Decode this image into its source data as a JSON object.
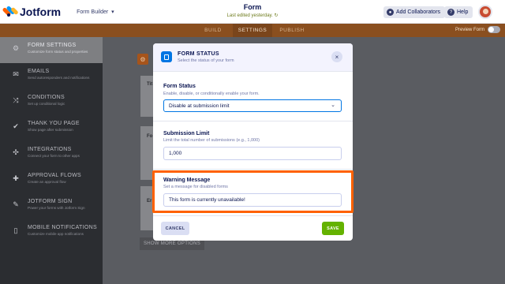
{
  "topbar": {
    "brand": "Jotform",
    "form_builder": "Form Builder",
    "form_builder_chevron": "▾",
    "doc_title": "Form",
    "last_edited": "Last edited yesterday.",
    "add_collaborators": "Add Collaborators",
    "help": "Help",
    "help_glyph": "?"
  },
  "tabs": {
    "items": [
      "BUILD",
      "SETTINGS",
      "PUBLISH"
    ],
    "active": "SETTINGS",
    "preview_form": "Preview Form"
  },
  "sidebar": {
    "items": [
      {
        "title": "FORM SETTINGS",
        "sub": "Customize form status and properties",
        "icon": "gear-icon",
        "glyph": "⚙"
      },
      {
        "title": "EMAILS",
        "sub": "Send autoresponders and notifications",
        "icon": "envelope-icon",
        "glyph": "✉"
      },
      {
        "title": "CONDITIONS",
        "sub": "Set up conditional logic",
        "icon": "shuffle-icon",
        "glyph": "⤨"
      },
      {
        "title": "THANK YOU PAGE",
        "sub": "Show page after submission",
        "icon": "check-circle-icon",
        "glyph": "✔"
      },
      {
        "title": "INTEGRATIONS",
        "sub": "Connect your form to other apps",
        "icon": "puzzle-icon",
        "glyph": "✣"
      },
      {
        "title": "APPROVAL FLOWS",
        "sub": "Create an approval flow",
        "icon": "flow-icon",
        "glyph": "✚"
      },
      {
        "title": "JOTFORM SIGN",
        "sub": "Power your forms with Jotform Sign",
        "icon": "pen-icon",
        "glyph": "✎"
      },
      {
        "title": "MOBILE NOTIFICATIONS",
        "sub": "Customize mobile app notifications",
        "icon": "phone-icon",
        "glyph": "▯"
      }
    ]
  },
  "background": {
    "orange_glyph": "⚙",
    "labels": [
      "Tit",
      "Fo",
      "Er"
    ],
    "show_more": "SHOW MORE OPTIONS"
  },
  "modal": {
    "title": "FORM STATUS",
    "subtitle": "Select the status of your form",
    "close_glyph": "×",
    "form_status": {
      "label": "Form Status",
      "help": "Enable, disable, or conditionally enable your form.",
      "value": "Disable at submission limit",
      "chevron": "⌄"
    },
    "submission_limit": {
      "label": "Submission Limit",
      "help": "Limit the total number of submissions (e.g., 1,000)",
      "value": "1,000"
    },
    "warning_message": {
      "label": "Warning Message",
      "help": "Set a message for disabled forms",
      "value": "This form is currently unavailable!"
    },
    "cancel": "CANCEL",
    "save": "SAVE"
  },
  "colors": {
    "accent": "#0075e3",
    "highlight": "#ff6100",
    "save": "#64b200",
    "tabbar": "#8a4f1f"
  }
}
